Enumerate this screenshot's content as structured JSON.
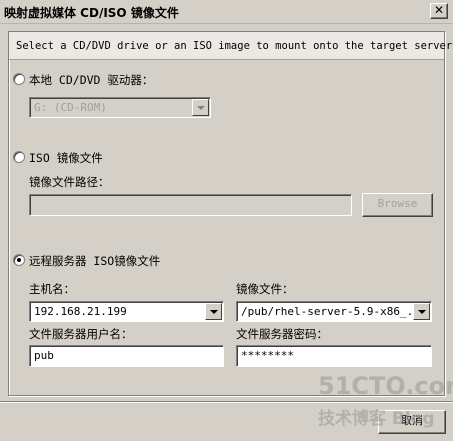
{
  "window": {
    "title": "映射虚拟媒体 CD/ISO 镜像文件",
    "close_glyph": "✕"
  },
  "description": "Select a CD/DVD drive or an ISO image to mount onto the target server.",
  "local_drive": {
    "label": "本地 CD/DVD 驱动器：",
    "selected": false,
    "value": "G: (CD-ROM)"
  },
  "iso_image": {
    "label": "ISO 镜像文件",
    "selected": false,
    "path_label": "镜像文件路径：",
    "path_value": "",
    "browse_label": "Browse"
  },
  "remote_server": {
    "label": "远程服务器 ISO镜像文件",
    "selected": true,
    "host_label": "主机名：",
    "host_value": "192.168.21.199",
    "image_label": "镜像文件：",
    "image_value": "/pub/rhel-server-5.9-x86_...",
    "user_label": "文件服务器用户名：",
    "user_value": "pub",
    "password_label": "文件服务器密码：",
    "password_value": "********"
  },
  "footer": {
    "cancel_label": "取消"
  },
  "watermark": {
    "line1": "51CTO.com",
    "line2": "技术博客 Blog"
  }
}
